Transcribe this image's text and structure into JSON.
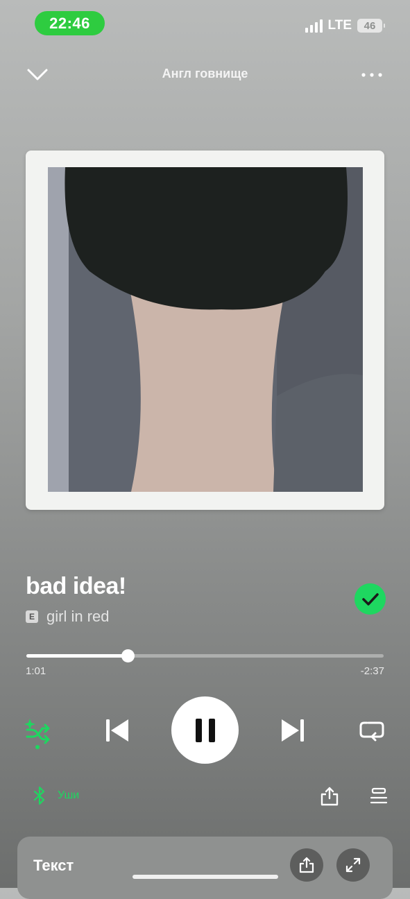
{
  "status_bar": {
    "time": "22:46",
    "network": "LTE",
    "battery": "46"
  },
  "header": {
    "playlist_title": "Англ говнище",
    "collapse_icon": "chevron-down-icon",
    "more_icon": "more-horizontal-icon"
  },
  "album_art": {
    "description_icon": "album-cover-image"
  },
  "track": {
    "title": "bad idea!",
    "explicit_badge": "E",
    "artist": "girl in red",
    "liked": true,
    "accent_color": "#1ed760"
  },
  "progress": {
    "elapsed": "1:01",
    "remaining": "-2:37",
    "fraction": 0.284
  },
  "controls": {
    "shuffle_icon": "smart-shuffle-icon",
    "previous_icon": "skip-previous-icon",
    "play_state_icon": "pause-icon",
    "next_icon": "skip-next-icon",
    "repeat_icon": "repeat-icon"
  },
  "device": {
    "icon": "bluetooth-icon",
    "name": "Уши"
  },
  "bottom_actions": {
    "share_icon": "share-icon",
    "queue_icon": "queue-icon"
  },
  "lyrics": {
    "title": "Текст",
    "share_icon": "share-icon",
    "expand_icon": "expand-icon"
  }
}
